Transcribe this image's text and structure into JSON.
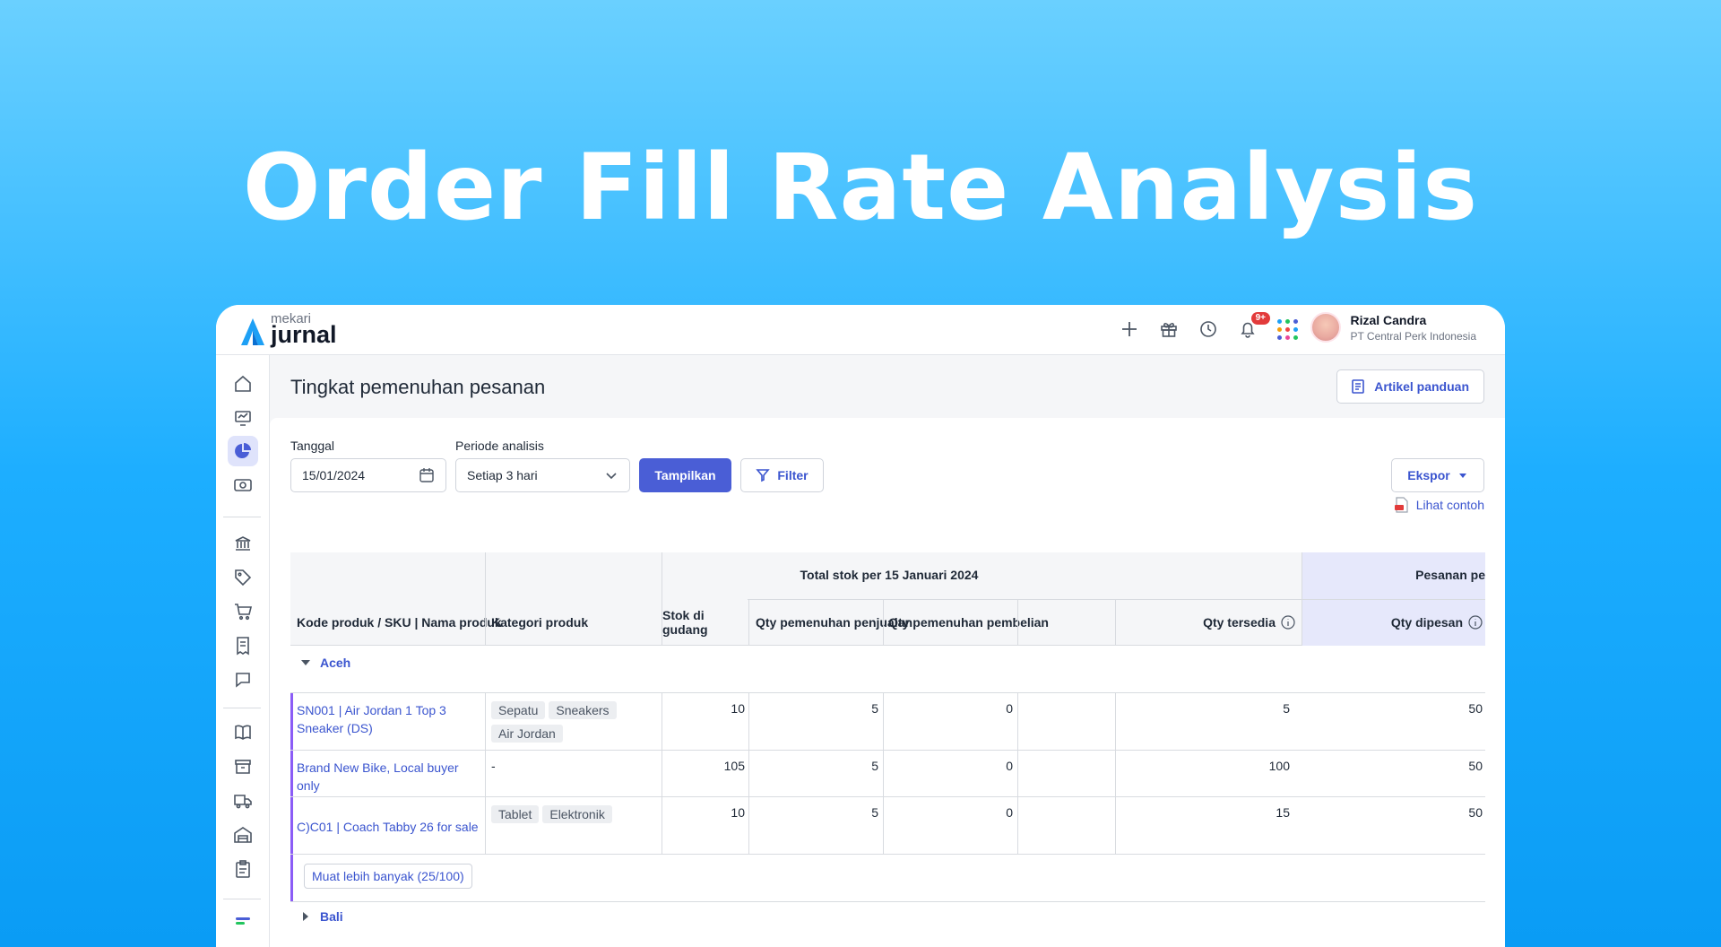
{
  "hero": {
    "title": "Order Fill Rate Analysis"
  },
  "brand": {
    "small": "mekari",
    "big": "jurnal"
  },
  "topbar": {
    "notifications_badge": "9+",
    "user_name": "Rizal Candra",
    "user_company": "PT Central Perk Indonesia"
  },
  "sidebar": {
    "icons": [
      "home-icon",
      "dashboard-icon",
      "report-pie-icon",
      "cash-icon",
      "bank-icon",
      "tag-icon",
      "cart-icon",
      "receipt-icon",
      "chat-icon",
      "book-icon",
      "archive-icon",
      "truck-icon",
      "warehouse-icon",
      "clipboard-icon",
      "more-icon"
    ],
    "active": "report-pie-icon"
  },
  "page": {
    "title": "Tingkat pemenuhan pesanan",
    "guide_label": "Artikel panduan"
  },
  "filters": {
    "date_label": "Tanggal",
    "date_value": "15/01/2024",
    "period_label": "Periode analisis",
    "period_value": "Setiap 3 hari",
    "show_label": "Tampilkan",
    "filter_label": "Filter",
    "export_label": "Ekspor",
    "example_label": "Lihat contoh"
  },
  "table": {
    "group_header": "Total stok per 15 Januari 2024",
    "orders_header": "Pesanan pe",
    "columns": {
      "product": "Kode produk / SKU | Nama produk",
      "category": "Kategori produk",
      "stock": "Stok di gudang",
      "sales_fill": "Qty pemenuhan penjualan",
      "purchase_fill": "Qty pemenuhan pembelian",
      "available": "Qty tersedia",
      "ordered": "Qty dipesan"
    },
    "groups": [
      {
        "name": "Aceh",
        "expanded": true,
        "rows": [
          {
            "product": "SN001 | Air Jordan 1 Top 3 Sneaker (DS)",
            "tags": [
              "Sepatu",
              "Sneakers",
              "Air Jordan"
            ],
            "category_text": "",
            "stock": "10",
            "sales_fill": "5",
            "purchase_fill": "0",
            "available": "5",
            "ordered": "50"
          },
          {
            "product": "Brand New Bike, Local buyer only",
            "tags": [],
            "category_text": "-",
            "stock": "105",
            "sales_fill": "5",
            "purchase_fill": "0",
            "available": "100",
            "ordered": "50"
          },
          {
            "product": "C)C01 | Coach Tabby 26 for sale",
            "tags": [
              "Tablet",
              "Elektronik"
            ],
            "category_text": "",
            "stock": "10",
            "sales_fill": "5",
            "purchase_fill": "0",
            "available": "15",
            "ordered": "50"
          }
        ],
        "load_more": "Muat lebih banyak (25/100)"
      },
      {
        "name": "Bali",
        "expanded": false
      }
    ]
  },
  "colors": {
    "accent": "#4a5ed6",
    "link": "#3b55cf",
    "row_accent": "#8b5cf6",
    "badge": "#e23b3b"
  }
}
